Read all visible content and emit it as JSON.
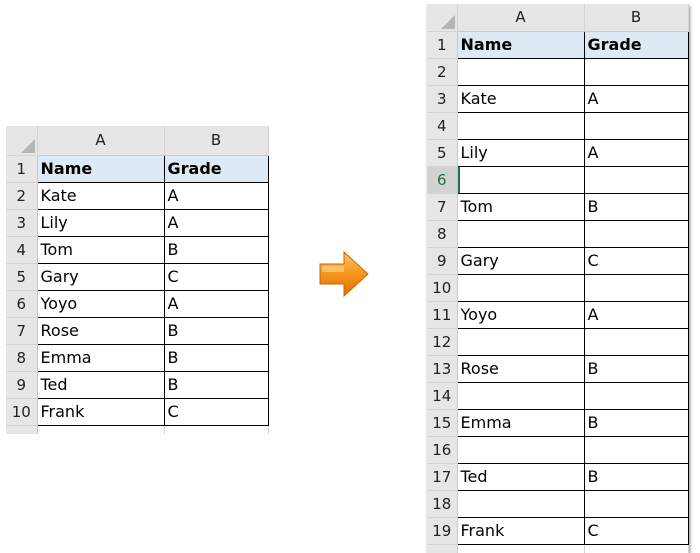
{
  "arrow_icon": "right-arrow",
  "left_sheet": {
    "columns": [
      "A",
      "B"
    ],
    "rows": [
      {
        "num": "1",
        "name": "Name",
        "grade": "Grade"
      },
      {
        "num": "2",
        "name": "Kate",
        "grade": "A"
      },
      {
        "num": "3",
        "name": "Lily",
        "grade": "A"
      },
      {
        "num": "4",
        "name": "Tom",
        "grade": "B"
      },
      {
        "num": "5",
        "name": "Gary",
        "grade": "C"
      },
      {
        "num": "6",
        "name": "Yoyo",
        "grade": "A"
      },
      {
        "num": "7",
        "name": "Rose",
        "grade": "B"
      },
      {
        "num": "8",
        "name": "Emma",
        "grade": "B"
      },
      {
        "num": "9",
        "name": "Ted",
        "grade": "B"
      },
      {
        "num": "10",
        "name": "Frank",
        "grade": "C"
      }
    ]
  },
  "right_sheet": {
    "columns": [
      "A",
      "B"
    ],
    "selected_row": "6",
    "rows": [
      {
        "num": "1",
        "name": "Name",
        "grade": "Grade"
      },
      {
        "num": "2",
        "name": "",
        "grade": ""
      },
      {
        "num": "3",
        "name": "Kate",
        "grade": "A"
      },
      {
        "num": "4",
        "name": "",
        "grade": ""
      },
      {
        "num": "5",
        "name": "Lily",
        "grade": "A"
      },
      {
        "num": "6",
        "name": "",
        "grade": ""
      },
      {
        "num": "7",
        "name": "Tom",
        "grade": "B"
      },
      {
        "num": "8",
        "name": "",
        "grade": ""
      },
      {
        "num": "9",
        "name": "Gary",
        "grade": "C"
      },
      {
        "num": "10",
        "name": "",
        "grade": ""
      },
      {
        "num": "11",
        "name": "Yoyo",
        "grade": "A"
      },
      {
        "num": "12",
        "name": "",
        "grade": ""
      },
      {
        "num": "13",
        "name": "Rose",
        "grade": "B"
      },
      {
        "num": "14",
        "name": "",
        "grade": ""
      },
      {
        "num": "15",
        "name": "Emma",
        "grade": "B"
      },
      {
        "num": "16",
        "name": "",
        "grade": ""
      },
      {
        "num": "17",
        "name": "Ted",
        "grade": "B"
      },
      {
        "num": "18",
        "name": "",
        "grade": ""
      },
      {
        "num": "19",
        "name": "Frank",
        "grade": "C"
      }
    ]
  }
}
